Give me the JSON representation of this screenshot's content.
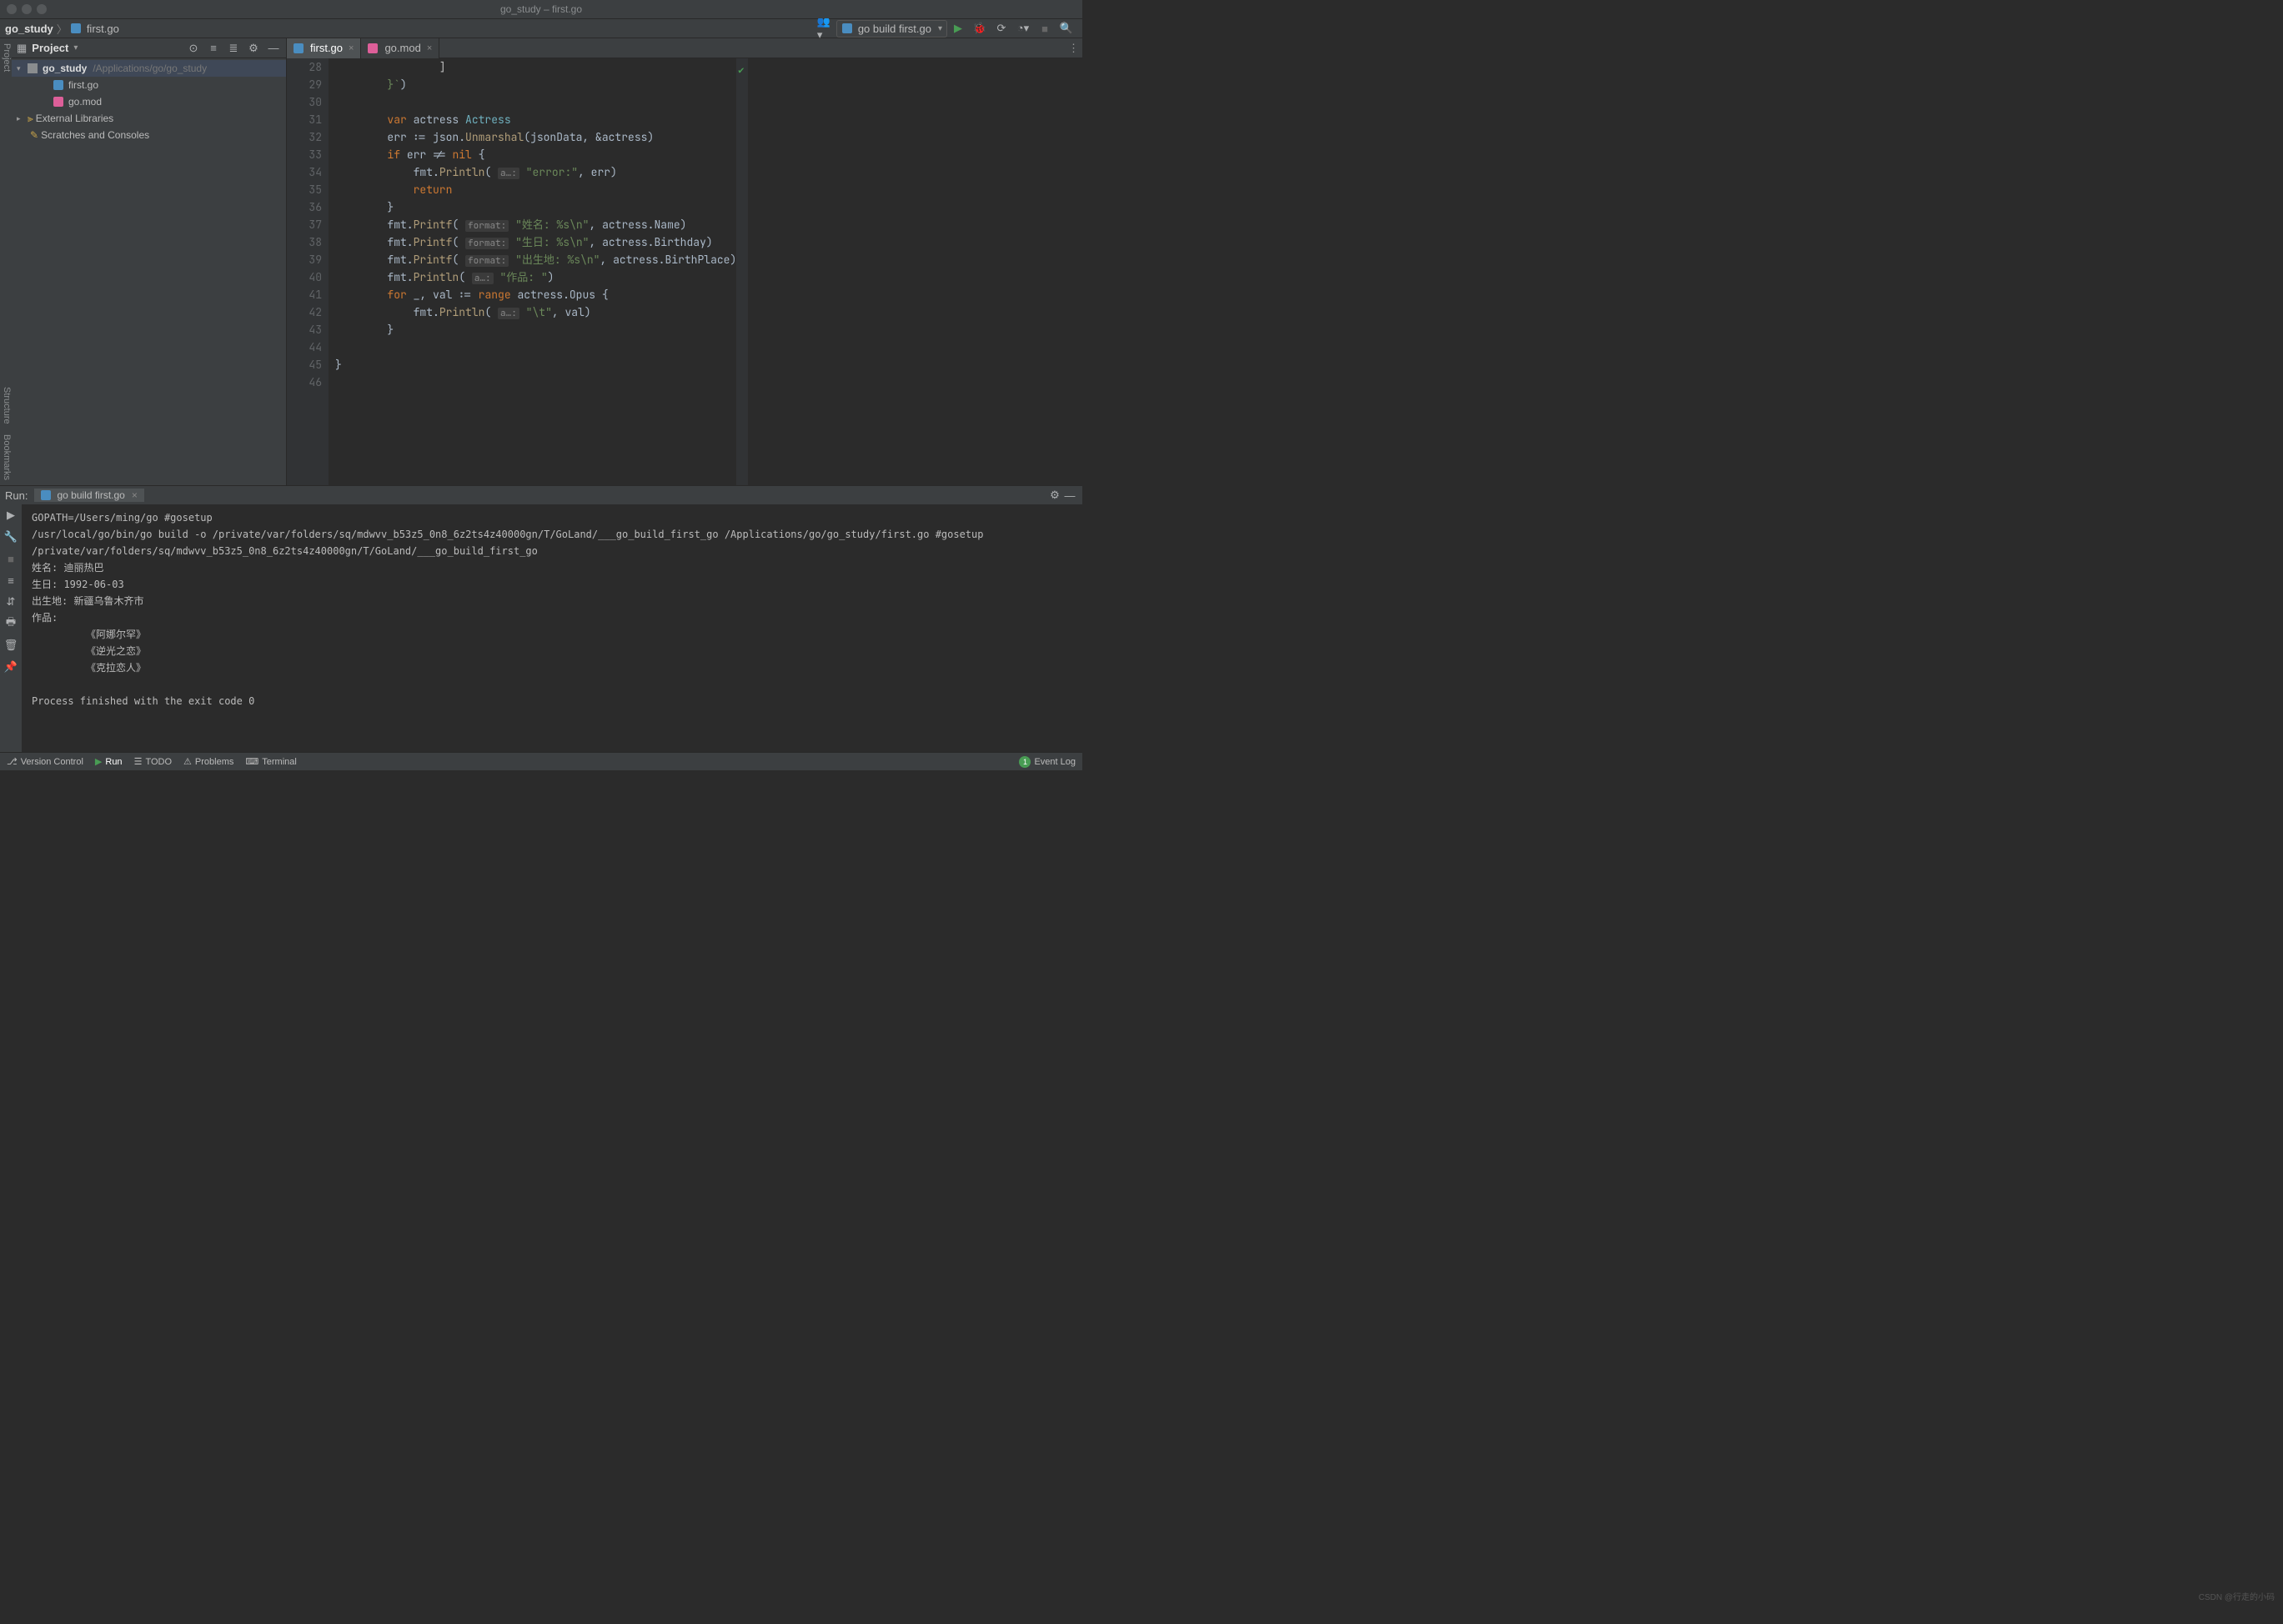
{
  "title": "go_study – first.go",
  "breadcrumbs": {
    "root": "go_study",
    "file": "first.go"
  },
  "toolbar": {
    "run_config": "go build first.go",
    "icons": {
      "users": "users-icon",
      "run": "run-icon",
      "debug": "bug-icon",
      "cov": "coverage-icon",
      "profile": "profile-icon",
      "stop": "stop-icon",
      "search": "search-icon"
    }
  },
  "project": {
    "title": "Project",
    "header_icons": [
      "target-icon",
      "expand-icon",
      "collapse-icon",
      "gear-icon",
      "minimize-icon"
    ],
    "root": {
      "name": "go_study",
      "path": "/Applications/go/go_study"
    },
    "files": [
      {
        "icon": "go",
        "name": "first.go"
      },
      {
        "icon": "mod",
        "name": "go.mod"
      }
    ],
    "ext_libs": "External Libraries",
    "scratches": "Scratches and Consoles"
  },
  "tabs": [
    {
      "name": "first.go",
      "active": true,
      "icon": "go"
    },
    {
      "name": "go.mod",
      "active": false,
      "icon": "mod"
    }
  ],
  "code": {
    "start": 28,
    "lines": [
      {
        "n": 28,
        "html": "                ]"
      },
      {
        "n": 29,
        "html": "        <span class='s'>}`</span><span class='c'>)</span>"
      },
      {
        "n": 30,
        "html": ""
      },
      {
        "n": 31,
        "html": "        <span class='k'>var</span> <span class='c'>actress </span><span class='t'>Actress</span>"
      },
      {
        "n": 32,
        "html": "        <span class='c'>err := </span><span class='c'>json.</span><span class='fn'>Unmarshal</span><span class='c'>(jsonData, &amp;actress)</span>"
      },
      {
        "n": 33,
        "html": "        <span class='k'>if</span> <span class='c'>err != </span><span class='k'>nil</span> <span class='c'>{</span>"
      },
      {
        "n": 34,
        "html": "            <span class='c'>fmt.</span><span class='fn'>Println</span><span class='c'>(</span> <span class='prm'>a…:</span> <span class='s'>\"error:\"</span><span class='c'>, err)</span>"
      },
      {
        "n": 35,
        "html": "            <span class='k'>return</span>"
      },
      {
        "n": 36,
        "html": "        <span class='c'>}</span>"
      },
      {
        "n": 37,
        "html": "        <span class='c'>fmt.</span><span class='fn'>Printf</span><span class='c'>(</span> <span class='prm'>format:</span> <span class='s'>\"姓名: %s\\n\"</span><span class='c'>, actress.Name)</span>"
      },
      {
        "n": 38,
        "html": "        <span class='c'>fmt.</span><span class='fn'>Printf</span><span class='c'>(</span> <span class='prm'>format:</span> <span class='s'>\"生日: %s\\n\"</span><span class='c'>, actress.Birthday)</span>"
      },
      {
        "n": 39,
        "html": "        <span class='c'>fmt.</span><span class='fn'>Printf</span><span class='c'>(</span> <span class='prm'>format:</span> <span class='s'>\"出生地: %s\\n\"</span><span class='c'>, actress.BirthPlace)</span>"
      },
      {
        "n": 40,
        "html": "        <span class='c'>fmt.</span><span class='fn'>Println</span><span class='c'>(</span> <span class='prm'>a…:</span> <span class='s'>\"作品: \"</span><span class='c'>)</span>"
      },
      {
        "n": 41,
        "html": "        <span class='k'>for</span> <span class='c'>_, val := </span><span class='k'>range</span> <span class='c'>actress.Opus {</span>"
      },
      {
        "n": 42,
        "html": "            <span class='c'>fmt.</span><span class='fn'>Println</span><span class='c'>(</span> <span class='prm'>a…:</span> <span class='s'>\"\\t\"</span><span class='c'>, val)</span>"
      },
      {
        "n": 43,
        "html": "        <span class='c'>}</span>"
      },
      {
        "n": 44,
        "html": ""
      },
      {
        "n": 45,
        "html": "<span class='c'>}</span>"
      },
      {
        "n": 46,
        "html": ""
      }
    ]
  },
  "run": {
    "label": "Run:",
    "tab": "go build first.go",
    "output": [
      "GOPATH=/Users/ming/go #gosetup",
      "/usr/local/go/bin/go build -o /private/var/folders/sq/mdwvv_b53z5_0n8_6z2ts4z40000gn/T/GoLand/___go_build_first_go /Applications/go/go_study/first.go #gosetup",
      "/private/var/folders/sq/mdwvv_b53z5_0n8_6z2ts4z40000gn/T/GoLand/___go_build_first_go",
      "姓名: 迪丽热巴",
      "生日: 1992-06-03",
      "出生地: 新疆乌鲁木齐市",
      "作品: ",
      "\t 《阿娜尔罕》",
      "\t 《逆光之恋》",
      "\t 《克拉恋人》",
      "",
      "Process finished with the exit code 0"
    ]
  },
  "sidebars": {
    "left_top": "Project",
    "left_mid": "Bookmarks",
    "left_mid2": "Structure"
  },
  "status": {
    "vcs": "Version Control",
    "run": "Run",
    "todo": "TODO",
    "problems": "Problems",
    "terminal": "Terminal",
    "event_log": "Event Log",
    "event_badge": "1"
  },
  "watermark": "CSDN @行走的小码"
}
